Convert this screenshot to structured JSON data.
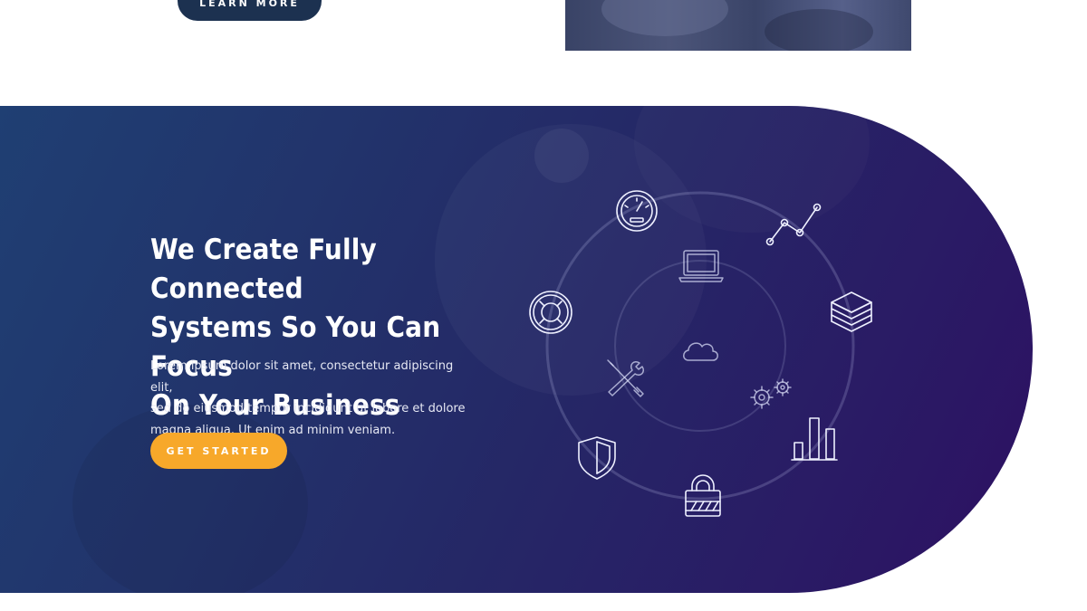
{
  "top": {
    "learn_more_label": "LEARN MORE"
  },
  "hero": {
    "headline_lines": [
      "We Create Fully Connected",
      "Systems So You Can Focus",
      "On Your Business"
    ],
    "body_lines": [
      "Lorem ipsum dolor sit amet, consectetur adipiscing elit,",
      "sed do eiusmod tempor incididunt ut labore et dolore",
      "magna aliqua. Ut enim ad minim veniam."
    ],
    "cta_label": "GET STARTED"
  },
  "diagram": {
    "icons": [
      "speedometer-icon",
      "line-chart-icon",
      "layers-icon",
      "bar-chart-icon",
      "lock-icon",
      "shield-icon",
      "lifebuoy-icon",
      "laptop-icon",
      "cloud-icon",
      "tools-icon",
      "gears-icon"
    ]
  },
  "colors": {
    "hero_gradient_start": "#1f3f73",
    "hero_gradient_end": "#2d1062",
    "cta": "#f7a82a",
    "learn_more_button": "#1c3150"
  }
}
